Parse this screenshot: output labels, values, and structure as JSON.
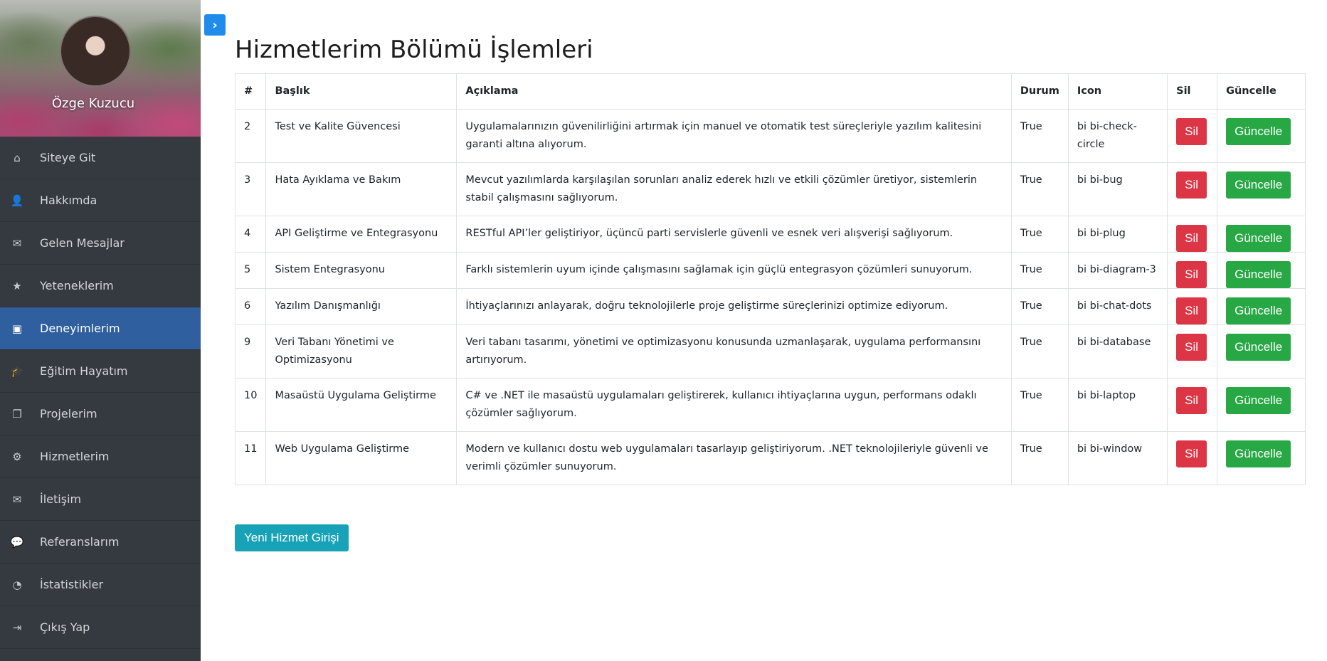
{
  "sidebar": {
    "profile_name": "Özge Kuzucu",
    "items": [
      {
        "label": "Siteye Git",
        "icon": "home-icon",
        "glyph": "⌂",
        "active": false
      },
      {
        "label": "Hakkımda",
        "icon": "user-icon",
        "glyph": "👤",
        "active": false
      },
      {
        "label": "Gelen Mesajlar",
        "icon": "inbox-icon",
        "glyph": "✉",
        "active": false
      },
      {
        "label": "Yeteneklerim",
        "icon": "star-icon",
        "glyph": "★",
        "active": false
      },
      {
        "label": "Deneyimlerim",
        "icon": "briefcase-icon",
        "glyph": "▣",
        "active": true
      },
      {
        "label": "Eğitim Hayatım",
        "icon": "graduation-cap-icon",
        "glyph": "🎓",
        "active": false
      },
      {
        "label": "Projelerim",
        "icon": "files-icon",
        "glyph": "❐",
        "active": false
      },
      {
        "label": "Hizmetlerim",
        "icon": "gears-icon",
        "glyph": "⚙",
        "active": false
      },
      {
        "label": "İletişim",
        "icon": "envelope-icon",
        "glyph": "✉",
        "active": false
      },
      {
        "label": "Referanslarım",
        "icon": "comments-icon",
        "glyph": "💬",
        "active": false
      },
      {
        "label": "İstatistikler",
        "icon": "pie-chart-icon",
        "glyph": "◔",
        "active": false
      },
      {
        "label": "Çıkış Yap",
        "icon": "sign-out-icon",
        "glyph": "⇥",
        "active": false
      }
    ]
  },
  "toggle_glyph": "›",
  "page": {
    "title": "Hizmetlerim Bölümü İşlemleri",
    "new_button": "Yeni Hizmet Girişi"
  },
  "table": {
    "headers": {
      "num": "#",
      "title": "Başlık",
      "desc": "Açıklama",
      "status": "Durum",
      "icon": "Icon",
      "delete": "Sil",
      "update": "Güncelle"
    },
    "delete_label": "Sil",
    "update_label": "Güncelle",
    "rows": [
      {
        "id": "2",
        "title": "Test ve Kalite Güvencesi",
        "desc": "Uygulamalarınızın güvenilirliğini artırmak için manuel ve otomatik test süreçleriyle yazılım kalitesini garanti altına alıyorum.",
        "status": "True",
        "icon": "bi bi-check-circle"
      },
      {
        "id": "3",
        "title": "Hata Ayıklama ve Bakım",
        "desc": "Mevcut yazılımlarda karşılaşılan sorunları analiz ederek hızlı ve etkili çözümler üretiyor, sistemlerin stabil çalışmasını sağlıyorum.",
        "status": "True",
        "icon": "bi bi-bug"
      },
      {
        "id": "4",
        "title": "API Geliştirme ve Entegrasyonu",
        "desc": "RESTful API’ler geliştiriyor, üçüncü parti servislerle güvenli ve esnek veri alışverişi sağlıyorum.",
        "status": "True",
        "icon": "bi bi-plug"
      },
      {
        "id": "5",
        "title": "Sistem Entegrasyonu",
        "desc": "Farklı sistemlerin uyum içinde çalışmasını sağlamak için güçlü entegrasyon çözümleri sunuyorum.",
        "status": "True",
        "icon": "bi bi-diagram-3"
      },
      {
        "id": "6",
        "title": "Yazılım Danışmanlığı",
        "desc": "İhtiyaçlarınızı anlayarak, doğru teknolojilerle proje geliştirme süreçlerinizi optimize ediyorum.",
        "status": "True",
        "icon": "bi bi-chat-dots"
      },
      {
        "id": "9",
        "title": "Veri Tabanı Yönetimi ve Optimizasyonu",
        "desc": "Veri tabanı tasarımı, yönetimi ve optimizasyonu konusunda uzmanlaşarak, uygulama performansını artırıyorum.",
        "status": "True",
        "icon": "bi bi-database"
      },
      {
        "id": "10",
        "title": "Masaüstü Uygulama Geliştirme",
        "desc": "C# ve .NET ile masaüstü uygulamaları geliştirerek, kullanıcı ihtiyaçlarına uygun, performans odaklı çözümler sağlıyorum.",
        "status": "True",
        "icon": "bi bi-laptop"
      },
      {
        "id": "11",
        "title": "Web Uygulama Geliştirme",
        "desc": "Modern ve kullanıcı dostu web uygulamaları tasarlayıp geliştiriyorum. .NET teknolojileriyle güvenli ve verimli çözümler sunuyorum.",
        "status": "True",
        "icon": "bi bi-window"
      }
    ]
  },
  "colors": {
    "sidebar_bg": "#343a40",
    "active_bg": "#2f5f9e",
    "danger": "#dc3545",
    "success": "#28a745",
    "info": "#17a2b8",
    "toggle": "#1f8cec"
  }
}
